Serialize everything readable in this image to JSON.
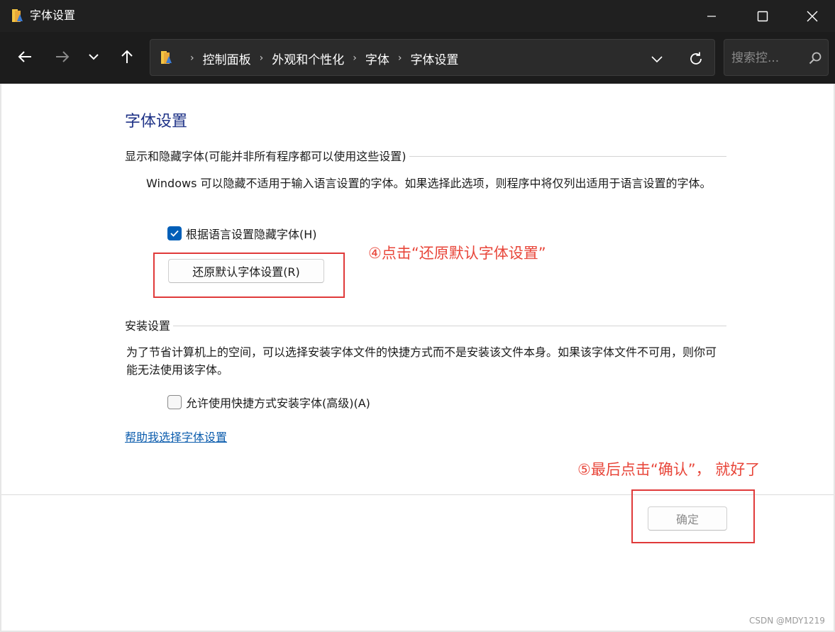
{
  "window": {
    "title": "字体设置"
  },
  "navigation": {
    "breadcrumb": [
      "控制面板",
      "外观和个性化",
      "字体",
      "字体设置"
    ],
    "breadcrumb_separator": "›",
    "search_placeholder": "搜索控..."
  },
  "page": {
    "title": "字体设置",
    "section_display": {
      "header": "显示和隐藏字体(可能并非所有程序都可以使用这些设置)",
      "description": "Windows 可以隐藏不适用于输入语言设置的字体。如果选择此选项，则程序中将仅列出适用于语言设置的字体。",
      "checkbox_label": "根据语言设置隐藏字体(H)",
      "checkbox_checked": true,
      "restore_button": "还原默认字体设置(R)"
    },
    "section_install": {
      "header": "安装设置",
      "description": "为了节省计算机上的空间，可以选择安装字体文件的快捷方式而不是安装该文件本身。如果该字体文件不可用，则你可能无法使用该字体。",
      "checkbox_label": "允许使用快捷方式安装字体(高级)(A)",
      "checkbox_checked": false
    },
    "help_link": "帮助我选择字体设置",
    "ok_button": "确定"
  },
  "annotations": {
    "step4": "④点击“还原默认字体设置”",
    "step5": "⑤最后点击“确认”， 就好了",
    "color": "#e8463a"
  },
  "watermark": "CSDN @MDY1219",
  "colors": {
    "titlebar": "#202020",
    "navbar": "#1c1c1c",
    "accent": "#005fb8",
    "title_text": "#1e3287",
    "link": "#0b5cad"
  },
  "icons": {
    "title": "folder-icon",
    "back": "arrow-left-icon",
    "forward": "arrow-right-icon",
    "recent": "chevron-down-icon",
    "up": "arrow-up-icon",
    "refresh": "refresh-icon",
    "search": "search-icon"
  }
}
